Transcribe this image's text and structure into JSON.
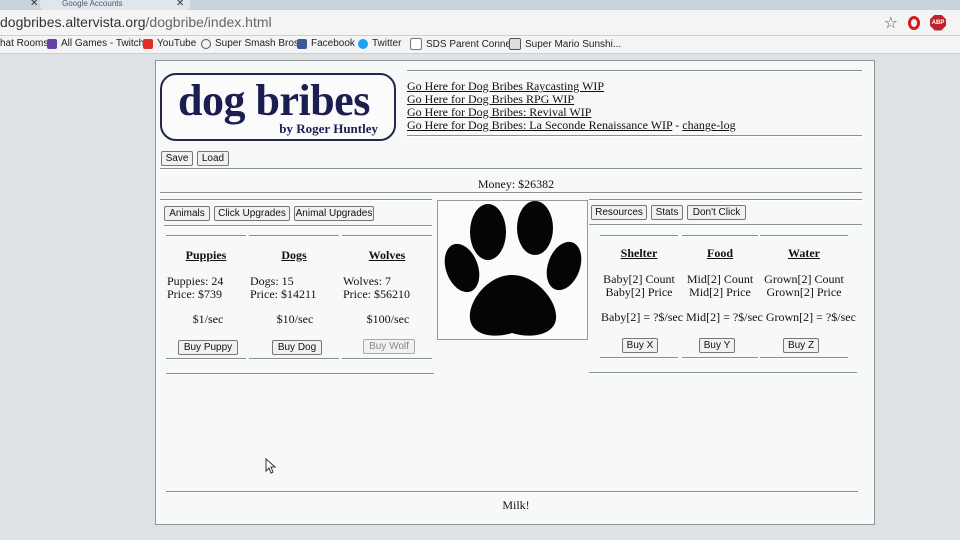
{
  "browser": {
    "tab_title": "Google Accounts",
    "url_host": "dogbribes.altervista.org",
    "url_path": "/dogbribe/index.html",
    "bookmarks": [
      "hat Rooms",
      "All Games - Twitch",
      "YouTube",
      "Super Smash Bros.",
      "Facebook",
      "Twitter",
      "SDS Parent Connect",
      "Super Mario Sunshi..."
    ],
    "abp_label": "ABP"
  },
  "logo": {
    "title": "dog bribes",
    "byline": "by Roger Huntley"
  },
  "links": {
    "raycasting": "Go Here for Dog Bribes Raycasting WIP",
    "rpg": "Go Here for Dog Bribes RPG WIP",
    "revival": "Go Here for Dog Bribes: Revival WIP",
    "renaissance": "Go Here for Dog Bribes: La Seconde Renaissance WIP",
    "separator": "-",
    "changelog": "change-log"
  },
  "toolbar": {
    "save": "Save",
    "load": "Load"
  },
  "money": "Money: $26382",
  "left_tabs": {
    "animals": "Animals",
    "click_upgrades": "Click Upgrades",
    "animal_upgrades": "Animal Upgrades"
  },
  "animals": [
    {
      "title": "Puppies",
      "count": "Puppies: 24",
      "price": "Price: $739",
      "rate": "$1/sec",
      "buy": "Buy Puppy"
    },
    {
      "title": "Dogs",
      "count": "Dogs: 15",
      "price": "Price: $14211",
      "rate": "$10/sec",
      "buy": "Buy Dog"
    },
    {
      "title": "Wolves",
      "count": "Wolves: 7",
      "price": "Price: $56210",
      "rate": "$100/sec",
      "buy": "Buy Wolf"
    }
  ],
  "right_tabs": {
    "resources": "Resources",
    "stats": "Stats",
    "dont_click": "Don't Click"
  },
  "resources": [
    {
      "title": "Shelter",
      "count": "Baby[2] Count",
      "price": "Baby[2] Price",
      "buy": "Buy X"
    },
    {
      "title": "Food",
      "count": "Mid[2] Count",
      "price": "Mid[2] Price",
      "buy": "Buy Y"
    },
    {
      "title": "Water",
      "count": "Grown[2] Count",
      "price": "Grown[2] Price",
      "buy": "Buy Z"
    }
  ],
  "resource_rates": "Baby[2] = ?$/sec Mid[2] = ?$/sec Grown[2] = ?$/sec",
  "footer": "Milk!"
}
